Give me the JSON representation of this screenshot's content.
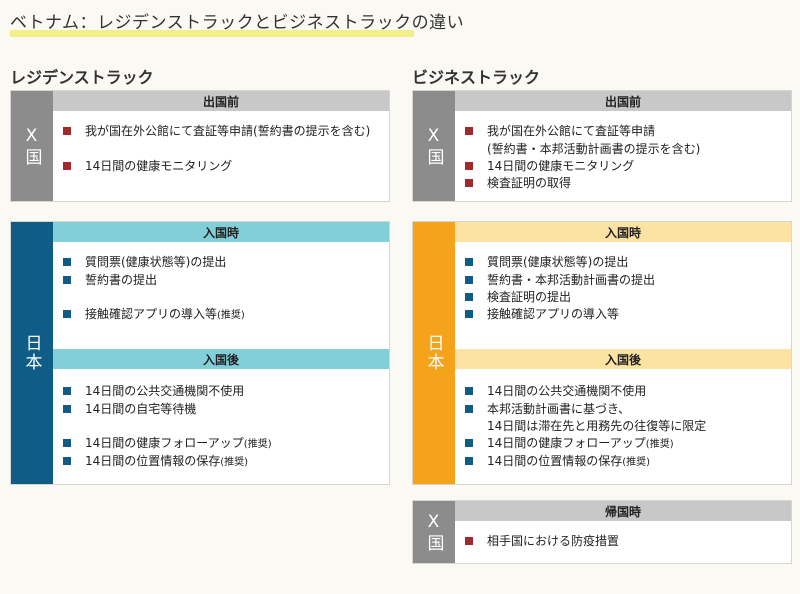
{
  "title": "ベトナム：レジデンストラックとビジネストラックの違い",
  "colors": {
    "gray": "#8c8c8c",
    "gray_head": "#c8c8c8",
    "navy": "#0f5d86",
    "cyan": "#82cfd9",
    "orange": "#f5a31a",
    "orange_head": "#fde3a3",
    "red": "#a1282b"
  },
  "residence": {
    "heading": "レジデンストラック",
    "depart": {
      "side": "X国",
      "header": "出国前",
      "items": [
        "我が国在外公館にて査証等申請(誓約書の提示を含む)",
        "14日間の健康モニタリング"
      ]
    },
    "japan": {
      "side": "日本",
      "entry_header": "入国時",
      "entry_items": [
        "質問票(健康状態等)の提出",
        "誓約書の提出",
        "接触確認アプリの導入等"
      ],
      "entry_note": "(推奨)",
      "after_header": "入国後",
      "after_items": [
        "14日間の公共交通機関不使用",
        "14日間の自宅等待機",
        "14日間の健康フォローアップ",
        "14日間の位置情報の保存"
      ],
      "after_note": "(推奨)"
    }
  },
  "business": {
    "heading": "ビジネストラック",
    "depart": {
      "side": "X国",
      "header": "出国前",
      "items": [
        "我が国在外公館にて査証等申請",
        "(誓約書・本邦活動計画書の提示を含む)",
        "14日間の健康モニタリング",
        "検査証明の取得"
      ]
    },
    "japan": {
      "side": "日本",
      "entry_header": "入国時",
      "entry_items": [
        "質問票(健康状態等)の提出",
        "誓約書・本邦活動計画書の提出",
        "検査証明の提出",
        "接触確認アプリの導入等"
      ],
      "after_header": "入国後",
      "after_items": [
        "14日間の公共交通機関不使用",
        "本邦活動計画書に基づき、",
        "14日間は滞在先と用務先の往復等に限定",
        "14日間の健康フォローアップ",
        "14日間の位置情報の保存"
      ],
      "after_note": "(推奨)"
    },
    "return": {
      "side": "X国",
      "header": "帰国時",
      "items": [
        "相手国における防疫措置"
      ]
    }
  }
}
